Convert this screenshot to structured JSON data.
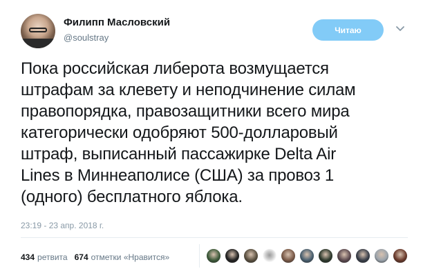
{
  "user": {
    "name": "Филипп Масловский",
    "handle": "@soulstray"
  },
  "follow_button": {
    "label": "Читаю",
    "color": "#1da1f2"
  },
  "menu_icon": "chevron-down-icon",
  "tweet": {
    "text": "Пока российская либерота возмущается\nштрафам за клевету и неподчинение силам\nправопорядка, правозащитники всего мира\nкатегорически одобряют 500-долларовый\nштраф, выписанный пассажирке Delta Air\nLines в Миннеаполисе (США) за провоз 1\n(одного) бесплатного яблока.",
    "timestamp": "23:19 - 23 апр. 2018 г."
  },
  "stats": {
    "retweets_count": "434",
    "retweets_label": "ретвита",
    "likes_count": "674",
    "likes_label": "отметки «Нравится»"
  },
  "likers": [
    {
      "color": "#3d5a3a"
    },
    {
      "color": "#222222"
    },
    {
      "color": "#5a5040"
    },
    {
      "color": "#ffffff"
    },
    {
      "color": "#7a5a48"
    },
    {
      "color": "#4a6070"
    },
    {
      "color": "#2e3a2e"
    },
    {
      "color": "#5c4a50"
    },
    {
      "color": "#3a3f4a"
    },
    {
      "color": "#9aa3ab"
    },
    {
      "color": "#6a3a2c"
    }
  ]
}
